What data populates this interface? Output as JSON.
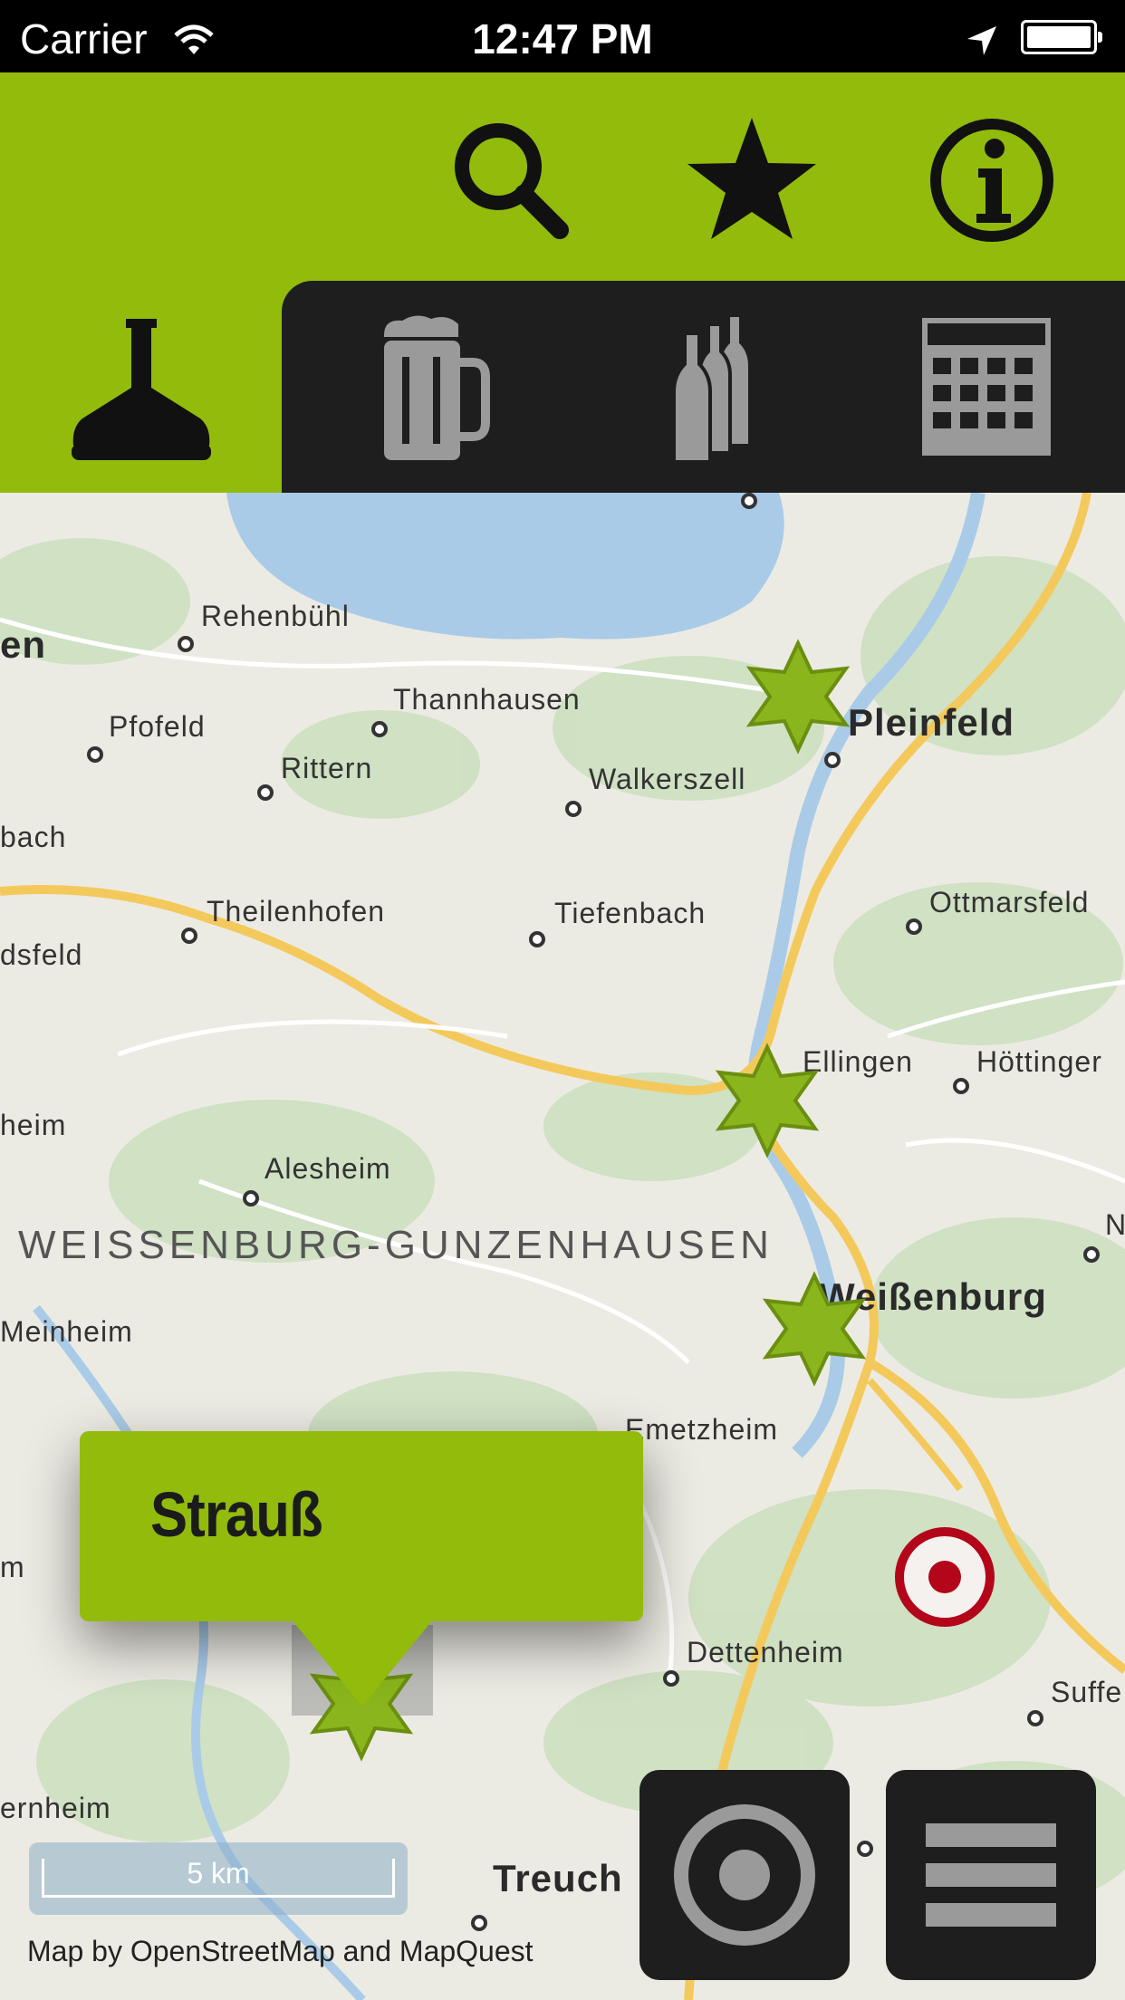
{
  "status_bar": {
    "carrier": "Carrier",
    "time": "12:47 PM"
  },
  "header": {
    "icons": [
      "search-icon",
      "star-icon",
      "info-icon"
    ]
  },
  "tabs": [
    {
      "name": "brewery",
      "icon": "brew-kettle-icon",
      "active": true
    },
    {
      "name": "beer",
      "icon": "beer-mug-icon",
      "active": false
    },
    {
      "name": "bottles",
      "icon": "bottles-icon",
      "active": false
    },
    {
      "name": "calendar",
      "icon": "calendar-icon",
      "active": false
    }
  ],
  "map": {
    "places": {
      "rehenbuehl": "Rehenbühl",
      "thannhausen": "Thannhausen",
      "pfofeld": "Pfofeld",
      "rittern": "Rittern",
      "walkerszell": "Walkerszell",
      "pleinfeld": "Pleinfeld",
      "bach": "bach",
      "en": "en",
      "theilenhofen": "Theilenhofen",
      "tiefenbach": "Tiefenbach",
      "ottmarsfeld": "Ottmarsfeld",
      "dsfeld": "dsfeld",
      "ellingen": "Ellingen",
      "hoettingen": "Höttinger",
      "heim": "heim",
      "alesheim": "Alesheim",
      "district": "WEISSENBURG-GUNZENHAUSEN",
      "n": "N",
      "meinheim": "Meinheim",
      "weissenburg": "Weißenburg",
      "emetzheim": "Emetzheim",
      "m": "m",
      "dettenheim": "Dettenheim",
      "suff": "Suffe",
      "ernheim": "ernheim",
      "treuch": "Treuch"
    },
    "callout_title": "Strauß",
    "scale_label": "5 km",
    "credit": "Map by OpenStreetMap and MapQuest"
  },
  "colors": {
    "accent": "#92bb0c",
    "dark": "#1e1e1e",
    "marker": "#8ab51c",
    "location": "#b3061a"
  }
}
